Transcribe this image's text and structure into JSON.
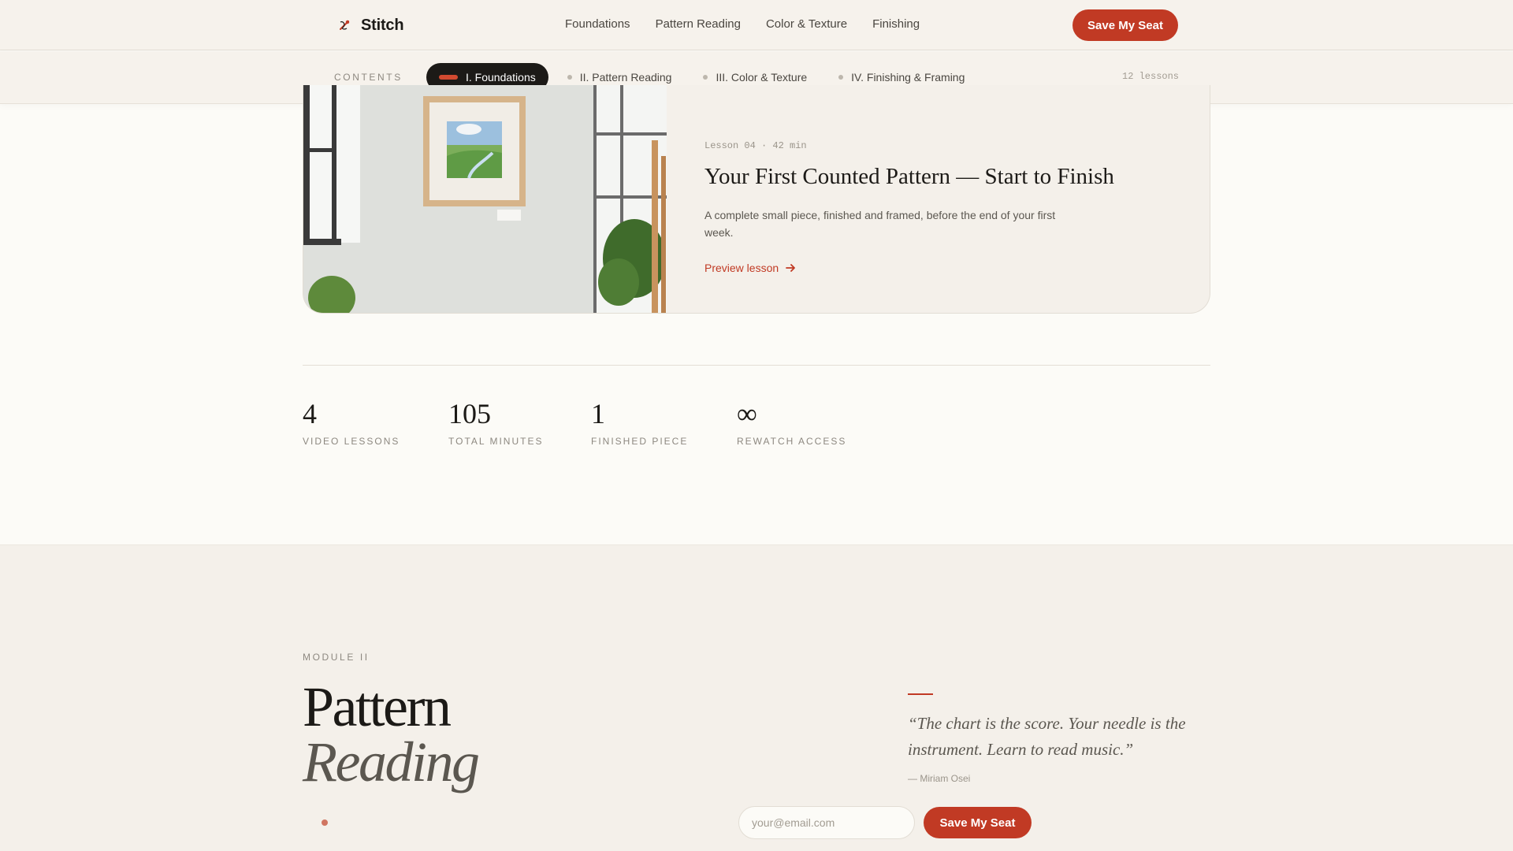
{
  "brand": {
    "name": "Stitch",
    "icon": "needle-thread-icon",
    "accent_color": "#c13a24"
  },
  "nav": {
    "links": [
      "Foundations",
      "Pattern Reading",
      "Color & Texture",
      "Finishing"
    ],
    "cta_label": "Save My Seat"
  },
  "contents": {
    "label": "CONTENTS",
    "chapters": [
      "I. Foundations",
      "II. Pattern Reading",
      "III. Color & Texture",
      "IV. Finishing & Framing"
    ],
    "active_chapter": "I. Foundations",
    "lessons_count": "12 lessons"
  },
  "lesson": {
    "meta": "Lesson 04 · 42 min",
    "title": "Your First Counted Pattern — Start to Finish",
    "description": "A complete small piece, finished and framed, before the end of your first week.",
    "link_label": "Preview lesson",
    "image": "framed-landscape-embroidery-on-wall"
  },
  "stats": [
    {
      "value": "4",
      "label": "VIDEO LESSONS"
    },
    {
      "value": "105",
      "label": "TOTAL MINUTES"
    },
    {
      "value": "1",
      "label": "FINISHED PIECE"
    },
    {
      "value": "∞",
      "label": "REWATCH ACCESS"
    }
  ],
  "module": {
    "eyebrow": "MODULE II",
    "title_line1": "Pattern",
    "title_line2": "Reading",
    "quote": "“The chart is the score. Your needle is the instrument. Learn to read music.”",
    "quote_author": "— Miriam Osei",
    "email_placeholder": "your@email.com",
    "cta_label": "Save My Seat"
  }
}
